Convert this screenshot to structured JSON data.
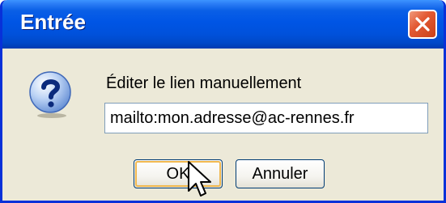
{
  "dialog": {
    "title": "Entrée",
    "prompt": "Éditer le lien manuellement",
    "url_value": "mailto:mon.adresse@ac-rennes.fr",
    "ok_label": "OK",
    "cancel_label": "Annuler"
  },
  "icons": {
    "close": "close-icon",
    "help": "question-icon",
    "cursor": "mouse-pointer-icon"
  },
  "colors": {
    "titlebar": "#0055e5",
    "dialog_bg": "#ece9d8",
    "close_button": "#e35a33",
    "focus_ring": "#f0b850"
  }
}
